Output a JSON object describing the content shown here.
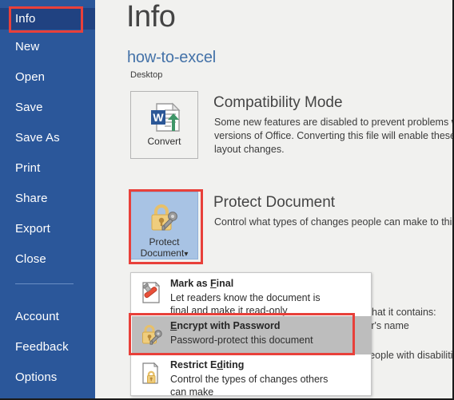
{
  "app": {
    "accent_blue": "#2b579a",
    "selected_blue": "#204281",
    "annotation_red": "#e8403a",
    "button_active_fill": "#a8c3e4",
    "background": "#f1f1ef"
  },
  "sidebar": {
    "items": [
      {
        "label": "Info",
        "selected": true
      },
      {
        "label": "New",
        "selected": false
      },
      {
        "label": "Open",
        "selected": false
      },
      {
        "label": "Save",
        "selected": false
      },
      {
        "label": "Save As",
        "selected": false
      },
      {
        "label": "Print",
        "selected": false
      },
      {
        "label": "Share",
        "selected": false
      },
      {
        "label": "Export",
        "selected": false
      },
      {
        "label": "Close",
        "selected": false
      },
      {
        "label": "Account",
        "selected": false
      },
      {
        "label": "Feedback",
        "selected": false
      },
      {
        "label": "Options",
        "selected": false
      }
    ]
  },
  "header": {
    "title": "Info",
    "document_name": "how-to-excel",
    "document_location": "Desktop"
  },
  "compatibility": {
    "button_label": "Convert",
    "button_icon": "word-document-upgrade-icon",
    "heading": "Compatibility Mode",
    "body_line1": "Some new features are disabled to prevent problems whe",
    "body_line2": "versions of Office. Converting this file will enable these fe",
    "body_line3": "layout changes."
  },
  "protect": {
    "button_label_line1": "Protect",
    "button_label_line2": "Document",
    "button_icon": "padlock-key-icon",
    "button_caret": "▾",
    "heading": "Protect Document",
    "body_line1": "Control what types of changes people can make to this d"
  },
  "inspect_behind": {
    "line1": "are that it contains:",
    "line2": "uthor's name",
    "line3": "d. People with disabilitie"
  },
  "dropdown": {
    "items": [
      {
        "title": "Mark as Final",
        "title_pre": "Mark as ",
        "title_accesskey": "F",
        "title_post": "inal",
        "desc_line1": "Let readers know the document is",
        "desc_line2": "final and make it read-only",
        "icon": "document-stamp-icon",
        "hovered": false
      },
      {
        "title": "Encrypt with Password",
        "title_pre": "",
        "title_accesskey": "E",
        "title_post": "ncrypt with Password",
        "desc_line1": "Password-protect this document",
        "desc_line2": "",
        "icon": "padlock-key-icon",
        "hovered": true
      },
      {
        "title": "Restrict Editing",
        "title_pre": "Restrict E",
        "title_accesskey": "d",
        "title_post": "iting",
        "desc_line1": "Control the types of changes others",
        "desc_line2": "can make",
        "icon": "document-lock-icon",
        "hovered": false
      }
    ]
  }
}
